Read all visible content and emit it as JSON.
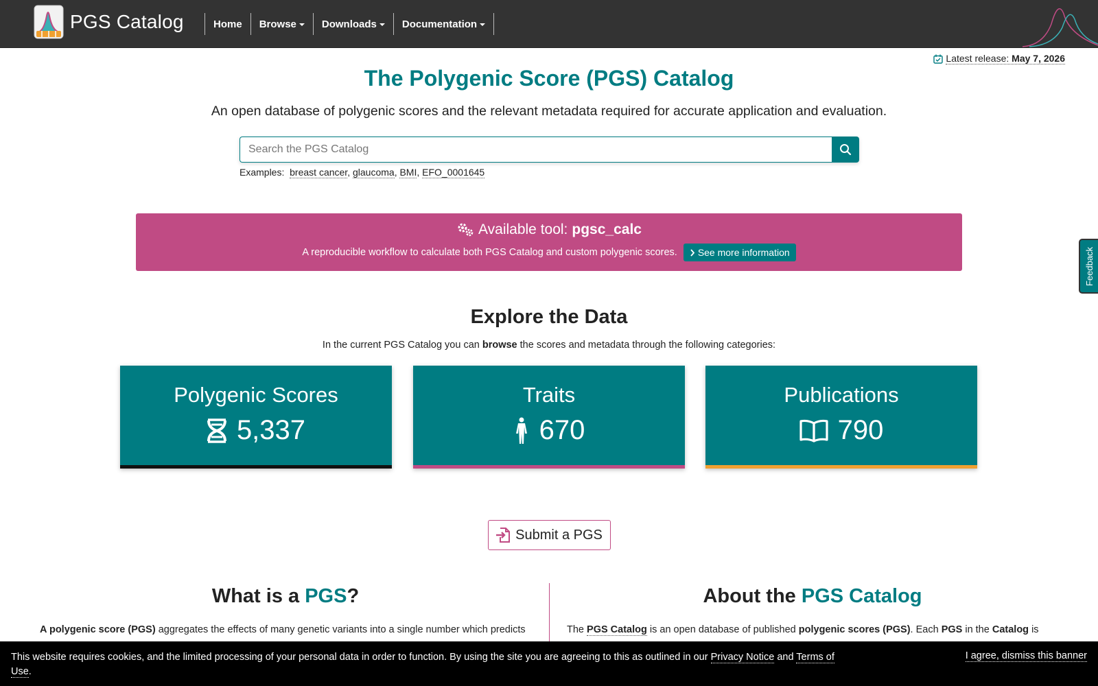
{
  "navbar": {
    "brand": "PGS Catalog",
    "items": [
      {
        "label": "Home"
      },
      {
        "label": "Browse"
      },
      {
        "label": "Downloads"
      },
      {
        "label": "Documentation"
      }
    ]
  },
  "release": {
    "label": "Latest release:",
    "date": "May 7, 2026"
  },
  "header": {
    "title": "The Polygenic Score (PGS) Catalog",
    "subtitle": "An open database of polygenic scores and the relevant metadata required for accurate application and evaluation."
  },
  "search": {
    "placeholder": "Search the PGS Catalog",
    "examples_label": "Examples:",
    "examples": [
      "breast cancer",
      "glaucoma",
      "BMI",
      "EFO_0001645"
    ]
  },
  "tool_banner": {
    "prefix": "Available tool:",
    "name": "pgsc_calc",
    "description": "A reproducible workflow to calculate both PGS Catalog and custom polygenic scores.",
    "button": "See more information"
  },
  "explore": {
    "title": "Explore the Data",
    "sub_prefix": "In the current PGS Catalog you can",
    "sub_bold": "browse",
    "sub_suffix": "the scores and metadata through the following categories:",
    "cards": [
      {
        "title": "Polygenic Scores",
        "count": "5,337",
        "icon": "dna-icon",
        "bar_color": "#111111"
      },
      {
        "title": "Traits",
        "count": "670",
        "icon": "person-icon",
        "bar_color": "#c04b84"
      },
      {
        "title": "Publications",
        "count": "790",
        "icon": "book-icon",
        "bar_color": "#f0a030"
      }
    ]
  },
  "submit": {
    "label": "Submit a PGS"
  },
  "what_is": {
    "title_prefix": "What is a",
    "title_accent": "PGS",
    "title_suffix": "?",
    "para_bold": "A polygenic score (PGS)",
    "para_text": "aggregates the effects of many genetic variants into a single number which predicts"
  },
  "about": {
    "title_prefix": "About the",
    "title_accent": "PGS Catalog",
    "p1": "The",
    "p_link": "PGS Catalog",
    "p2": "is an open database of published",
    "p_bold1": "polygenic scores (PGS)",
    "p3": ". Each",
    "p_bold2": "PGS",
    "p4": "in the",
    "p_bold3": "Catalog",
    "p5": "is"
  },
  "cookie": {
    "text": "This website requires cookies, and the limited processing of your personal data in order to function. By using the site you are agreeing to this as outlined in our",
    "privacy": "Privacy Notice",
    "and": "and",
    "terms": "Terms of Use",
    "end": ".",
    "dismiss": "I agree, dismiss this banner"
  },
  "feedback": {
    "label": "Feedback"
  },
  "colors": {
    "primary": "#007c82",
    "accent": "#c04b84",
    "orange": "#f0a030",
    "nav_bg": "#333333"
  }
}
